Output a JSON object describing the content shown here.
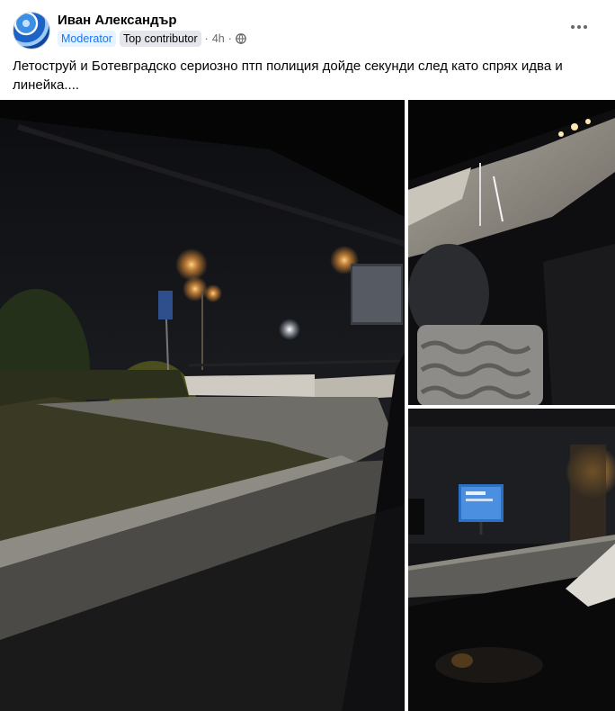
{
  "post": {
    "author": "Иван Александър",
    "badges": {
      "moderator": "Moderator",
      "top_contributor": "Top contributor"
    },
    "separator": "·",
    "time": "4h",
    "text": "Летоструй и Ботевградско сериозно птп полиция дойде секунди след като спрях идва и линейка....",
    "icons": {
      "avatar": "avatar-image",
      "privacy": "globe-icon",
      "more": "more-horizontal-icon"
    }
  },
  "colors": {
    "moderator_badge": "#1877f2",
    "meta_text": "#65676b",
    "text": "#050505"
  },
  "photos": [
    {
      "name": "night-street-through-car-window"
    },
    {
      "name": "car-interior-night-road"
    },
    {
      "name": "billboard-night-road"
    }
  ]
}
